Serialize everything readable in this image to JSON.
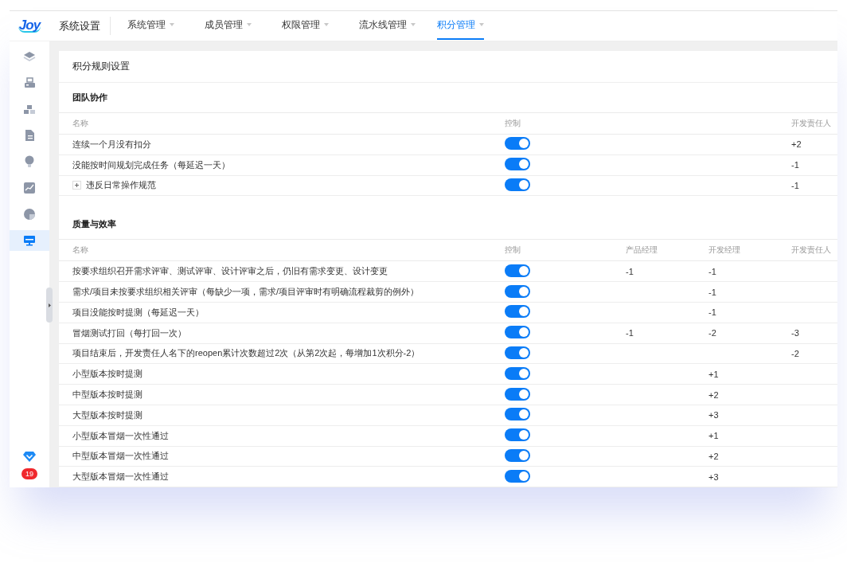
{
  "logo": {
    "text": "Joy"
  },
  "header": {
    "title": "系统设置"
  },
  "tabs": [
    {
      "label": "系统管理",
      "selected": false
    },
    {
      "label": "成员管理",
      "selected": false
    },
    {
      "label": "权限管理",
      "selected": false
    },
    {
      "label": "流水线管理",
      "selected": false
    },
    {
      "label": "积分管理",
      "selected": true
    }
  ],
  "sidebar": {
    "items": [
      {
        "selected": false
      },
      {
        "selected": false
      },
      {
        "selected": false
      },
      {
        "selected": false
      },
      {
        "selected": false
      },
      {
        "selected": false
      },
      {
        "selected": false
      },
      {
        "selected": true
      }
    ],
    "badge": "19"
  },
  "card": {
    "title": "积分规则设置"
  },
  "sections": [
    {
      "title": "团队协作",
      "name_column": "名称",
      "control_column": "控制",
      "score_columns": {
        "dev_owner": "开发责任人"
      },
      "rows": [
        {
          "kind": "rule",
          "name": "连续一个月没有扣分",
          "on": true,
          "scores": {
            "dev_owner": "+2"
          }
        },
        {
          "kind": "rule",
          "name": "没能按时间规划完成任务（每延迟一天）",
          "on": true,
          "scores": {
            "dev_owner": "-1"
          }
        },
        {
          "kind": "group",
          "expanded": false,
          "name": "违反日常操作规范",
          "on": true,
          "scores": {
            "dev_owner": "-1"
          }
        }
      ]
    },
    {
      "title": "质量与效率",
      "name_column": "名称",
      "control_column": "控制",
      "score_columns": {
        "product_manager": "产品经理",
        "dev_manager": "开发经理",
        "dev_owner": "开发责任人"
      },
      "rows": [
        {
          "kind": "rule",
          "name": "按要求组织召开需求评审、测试评审、设计评审之后，仍旧有需求变更、设计变更",
          "on": true,
          "scores": {
            "product_manager": "-1",
            "dev_manager": "-1"
          }
        },
        {
          "kind": "rule",
          "name": "需求/项目未按要求组织相关评审（每缺少一项，需求/项目评审时有明确流程裁剪的例外）",
          "on": true,
          "scores": {
            "dev_manager": "-1"
          }
        },
        {
          "kind": "rule",
          "name": "项目没能按时提测（每延迟一天）",
          "on": true,
          "scores": {
            "dev_manager": "-1"
          }
        },
        {
          "kind": "rule",
          "name": "冒烟测试打回（每打回一次）",
          "on": true,
          "scores": {
            "product_manager": "-1",
            "dev_manager": "-2",
            "dev_owner": "-3"
          }
        },
        {
          "kind": "rule",
          "name": "项目结束后，开发责任人名下的reopen累计次数超过2次（从第2次起，每增加1次积分-2）",
          "on": true,
          "scores": {
            "dev_owner": "-2"
          }
        },
        {
          "kind": "rule",
          "name": "小型版本按时提测",
          "on": true,
          "scores": {
            "dev_manager": "+1"
          }
        },
        {
          "kind": "rule",
          "name": "中型版本按时提测",
          "on": true,
          "scores": {
            "dev_manager": "+2"
          }
        },
        {
          "kind": "rule",
          "name": "大型版本按时提测",
          "on": true,
          "scores": {
            "dev_manager": "+3"
          }
        },
        {
          "kind": "rule",
          "name": "小型版本冒烟一次性通过",
          "on": true,
          "scores": {
            "dev_manager": "+1"
          }
        },
        {
          "kind": "rule",
          "name": "中型版本冒烟一次性通过",
          "on": true,
          "scores": {
            "dev_manager": "+2"
          }
        },
        {
          "kind": "rule",
          "name": "大型版本冒烟一次性通过",
          "on": true,
          "scores": {
            "dev_manager": "+3"
          }
        }
      ]
    }
  ]
}
